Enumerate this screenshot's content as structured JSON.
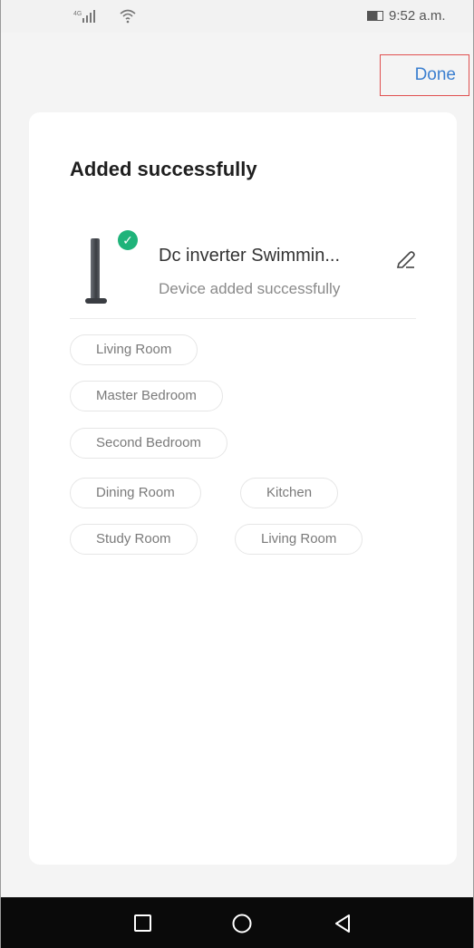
{
  "status_bar": {
    "network": "4G",
    "time": "9:52 a.m."
  },
  "header": {
    "done_label": "Done"
  },
  "card": {
    "title": "Added successfully",
    "device": {
      "name": "Dc inverter Swimmin...",
      "status": "Device added successfully"
    },
    "rooms": [
      "Living Room",
      "Master Bedroom",
      "Second Bedroom",
      "Dining Room",
      "Kitchen",
      "Study Room",
      "Living Room"
    ]
  },
  "colors": {
    "accent": "#3b7fd0",
    "success": "#1fb37a",
    "background": "#f4f4f4",
    "card": "#ffffff"
  },
  "icons": {
    "edit": "pencil-icon",
    "check": "check-icon",
    "nav_recent": "square-icon",
    "nav_home": "circle-icon",
    "nav_back": "triangle-back-icon"
  }
}
